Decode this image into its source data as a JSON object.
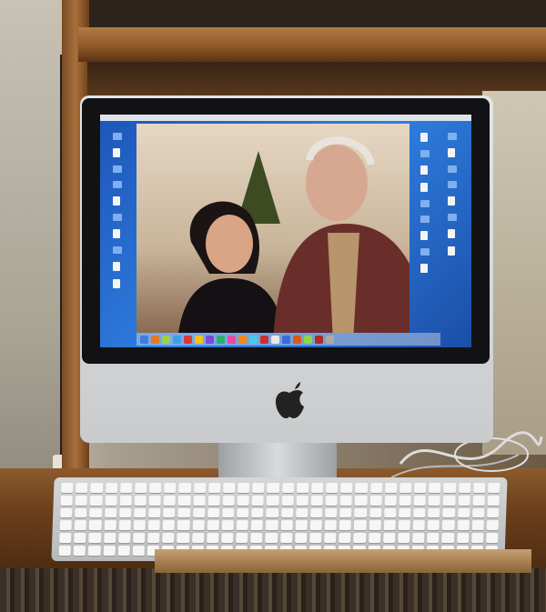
{
  "scene": {
    "kind": "photo",
    "subject": "imac-on-wooden-shelf",
    "colors": {
      "wall": "#b8b2a4",
      "wood": "#8a5526",
      "imac_silver": "#d6d8da",
      "screen_blue": "#2f7ee0",
      "bezel": "#121214"
    }
  },
  "icons": {
    "apple": "apple-logo-icon"
  }
}
